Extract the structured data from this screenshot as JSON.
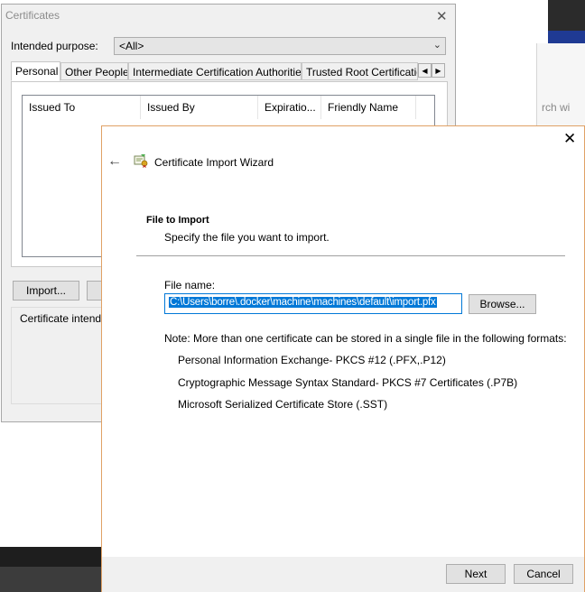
{
  "background": {
    "search_hint": "rch wi"
  },
  "certificates_dialog": {
    "title": "Certificates",
    "intended_purpose_label": "Intended purpose:",
    "intended_purpose_value": "<All>",
    "tabs": [
      "Personal",
      "Other People",
      "Intermediate Certification Authorities",
      "Trusted Root Certification"
    ],
    "columns": [
      "Issued To",
      "Issued By",
      "Expiratio...",
      "Friendly Name"
    ],
    "import_button": "Import...",
    "intended_purposes_label": "Certificate intended"
  },
  "wizard": {
    "title": "Certificate Import Wizard",
    "section_title": "File to Import",
    "section_subtitle": "Specify the file you want to import.",
    "file_name_label": "File name:",
    "file_name_value": "C:\\Users\\borre\\.docker\\machine\\machines\\default\\import.pfx",
    "browse_button": "Browse...",
    "note": "Note:  More than one certificate can be stored in a single file in the following formats:",
    "formats": [
      "Personal Information Exchange- PKCS #12 (.PFX,.P12)",
      "Cryptographic Message Syntax Standard- PKCS #7 Certificates (.P7B)",
      "Microsoft Serialized Certificate Store (.SST)"
    ],
    "next_button": "Next",
    "cancel_button": "Cancel"
  },
  "colors": {
    "selection": "#0078d7",
    "wizard_border": "#e0a165"
  }
}
